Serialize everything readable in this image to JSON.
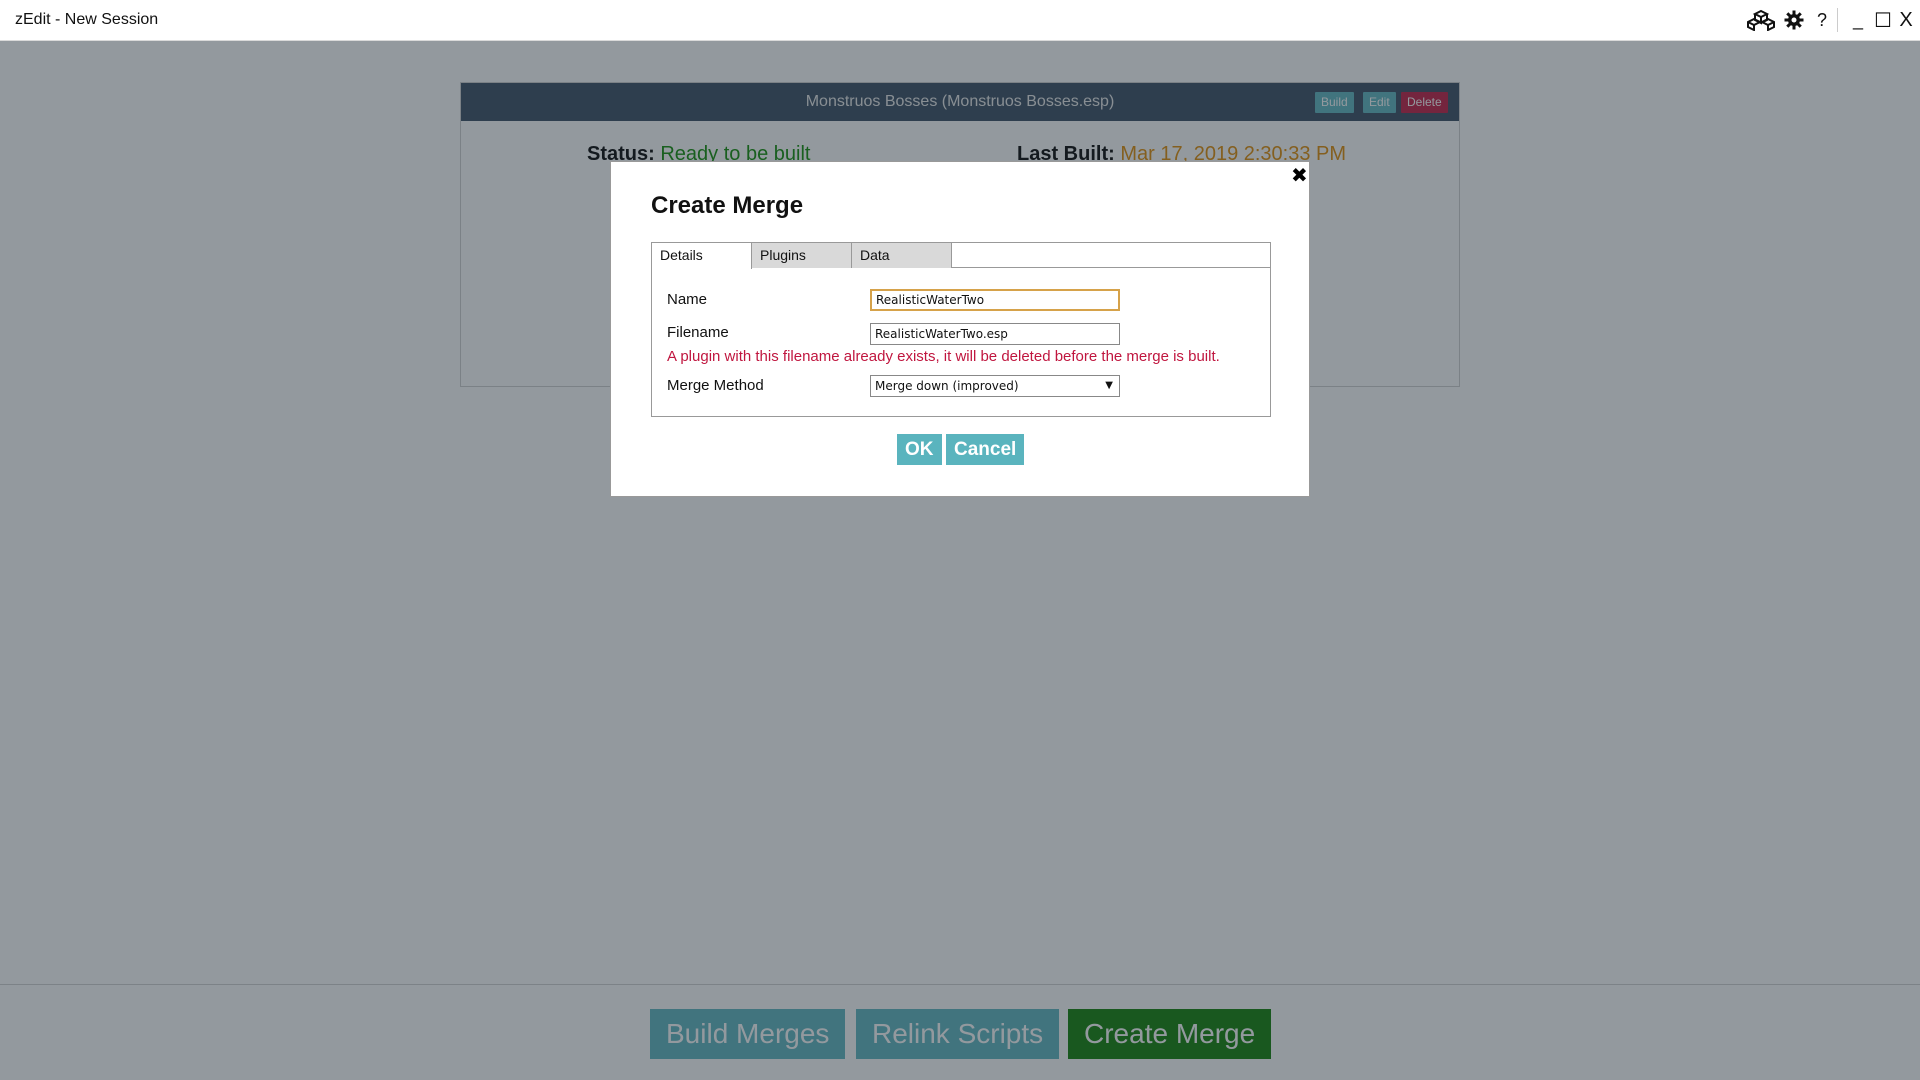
{
  "window": {
    "title": "zEdit - New Session",
    "controls": {
      "minimize": "_",
      "maximize": "☐",
      "close": "X",
      "help": "?"
    }
  },
  "merge_panel": {
    "header": "Monstruos Bosses (Monstruos Bosses.esp)",
    "build_label": "Build",
    "edit_label": "Edit",
    "delete_label": "Delete",
    "status_label": "Status:",
    "status_value": "Ready to be built",
    "last_built_label": "Last Built:",
    "last_built_value": "Mar 17, 2019 2:30:33 PM"
  },
  "bottom_bar": {
    "build_merges": "Build Merges",
    "relink_scripts": "Relink Scripts",
    "create_merge": "Create Merge"
  },
  "modal": {
    "title": "Create Merge",
    "close_glyph": "✖",
    "tabs": [
      {
        "label": "Details",
        "active": true
      },
      {
        "label": "Plugins",
        "active": false
      },
      {
        "label": "Data",
        "active": false
      }
    ],
    "name_label": "Name",
    "name_value": "RealisticWaterTwo",
    "filename_label": "Filename",
    "filename_value": "RealisticWaterTwo.esp",
    "warning": "A plugin with this filename already exists, it will be deleted before the merge is built.",
    "merge_method_label": "Merge Method",
    "merge_method_value": "Merge down (improved)",
    "ok_label": "OK",
    "cancel_label": "Cancel"
  },
  "colors": {
    "accent_teal": "#5ab4be",
    "create_green": "#0a7d00",
    "header_dark": "#34495e",
    "danger": "#c0163f",
    "status_ok": "#0a8a00",
    "last_built": "#e08a00"
  }
}
